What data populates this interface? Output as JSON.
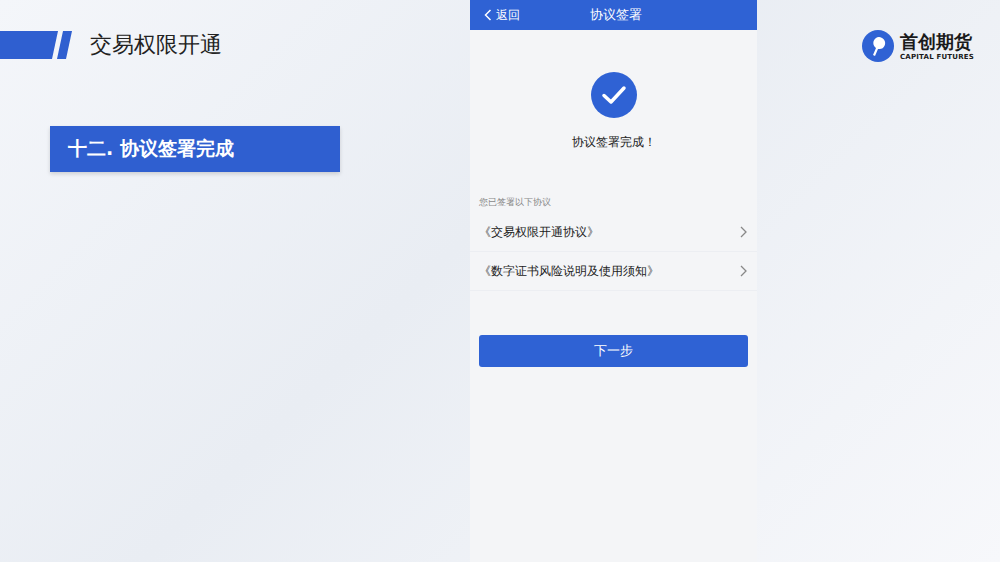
{
  "slide": {
    "title": "交易权限开通",
    "section": "十二. 协议签署完成",
    "logo": {
      "name": "首创期货",
      "subtitle": "CAPITAL FUTURES"
    }
  },
  "phone": {
    "header": {
      "back": "返回",
      "title": "协议签署"
    },
    "status": "协议签署完成！",
    "list_caption": "您已签署以下协议",
    "agreements": [
      "《交易权限开通协议》",
      "《数字证书风险说明及使用须知》"
    ],
    "button": "下一步"
  }
}
